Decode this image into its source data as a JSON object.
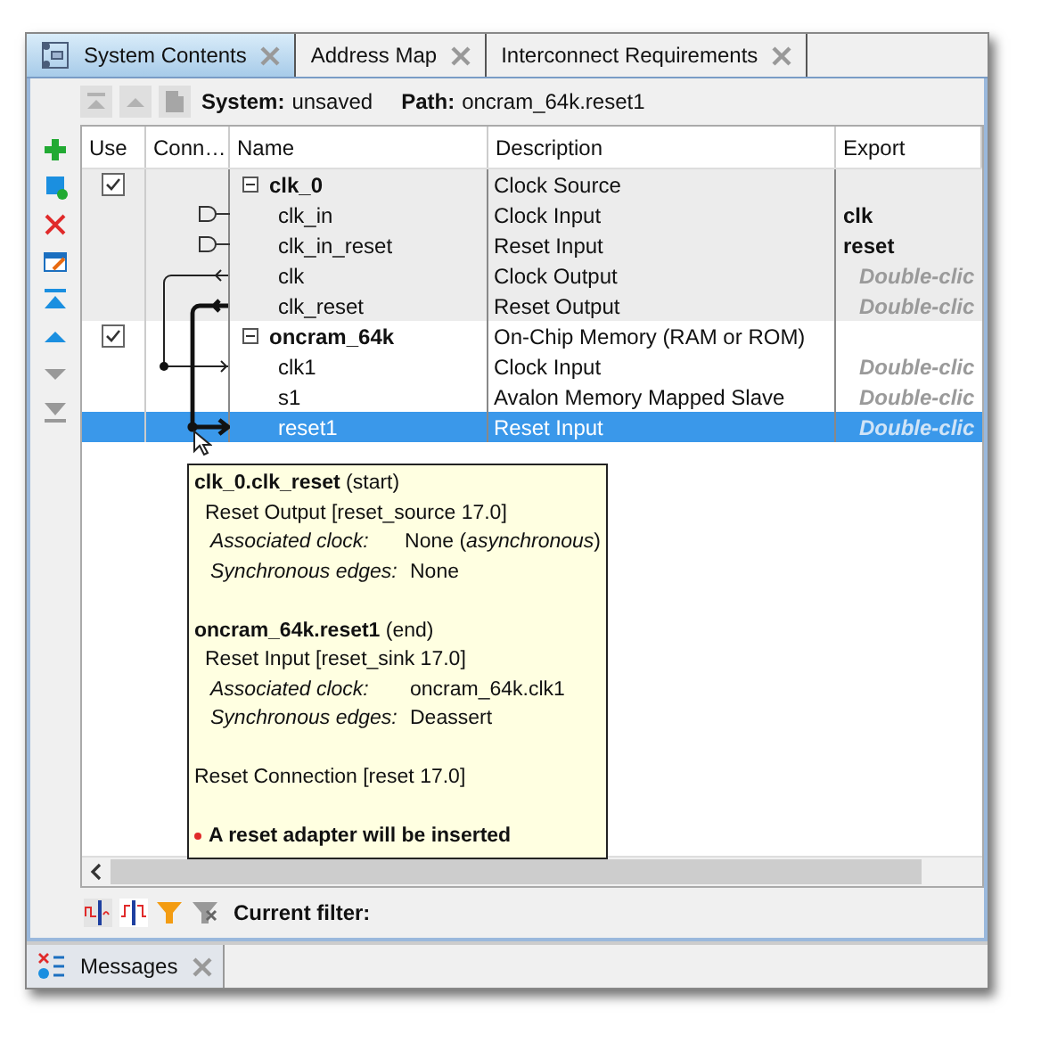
{
  "tabs": [
    {
      "label": "System Contents",
      "selected": true,
      "kind": "system"
    },
    {
      "label": "Address Map",
      "selected": false
    },
    {
      "label": "Interconnect Requirements",
      "selected": false
    }
  ],
  "toolbar": {
    "buttons": [
      {
        "kind": "top",
        "disabled": true
      },
      {
        "kind": "up",
        "disabled": true
      },
      {
        "kind": "hierarchy",
        "disabled": true
      }
    ],
    "system_label": "System:",
    "system_value": "unsaved",
    "path_label": "Path:",
    "path_value": "oncram_64k.reset1"
  },
  "side_tools": [
    {
      "kind": "add",
      "disabled": false
    },
    {
      "kind": "add-block",
      "disabled": false
    },
    {
      "kind": "remove",
      "disabled": false
    },
    {
      "kind": "edit",
      "disabled": false
    },
    {
      "kind": "top",
      "disabled": false
    },
    {
      "kind": "up",
      "disabled": false
    },
    {
      "kind": "down",
      "disabled": true
    },
    {
      "kind": "bottom",
      "disabled": true
    }
  ],
  "table": {
    "columns": [
      "Use",
      "Conn…",
      "Name",
      "Description",
      "Export"
    ],
    "modules": [
      {
        "name": "clk_0",
        "description": "Clock Source",
        "checked": true,
        "expanded": true,
        "selected": false,
        "children": [
          {
            "name": "clk_in",
            "description": "Clock Input",
            "export": "clk",
            "exported": true,
            "selected": false
          },
          {
            "name": "clk_in_reset",
            "description": "Reset Input",
            "export": "reset",
            "exported": true,
            "selected": false
          },
          {
            "name": "clk",
            "description": "Clock Output",
            "export": "Double-clic",
            "exported": false,
            "selected": false
          },
          {
            "name": "clk_reset",
            "description": "Reset Output",
            "export": "Double-clic",
            "exported": false,
            "selected": false
          }
        ]
      },
      {
        "name": "oncram_64k",
        "description": "On-Chip Memory (RAM or ROM)",
        "checked": true,
        "expanded": true,
        "selected": false,
        "children": [
          {
            "name": "clk1",
            "description": "Clock Input",
            "export": "Double-clic",
            "exported": false,
            "selected": false
          },
          {
            "name": "s1",
            "description": "Avalon Memory Mapped Slave",
            "export": "Double-clic",
            "exported": false,
            "selected": false
          },
          {
            "name": "reset1",
            "description": "Reset Input",
            "export": "Double-clic",
            "exported": false,
            "selected": true
          }
        ]
      }
    ]
  },
  "tooltip": {
    "lines": [
      {
        "kind": "heading",
        "text": "**clk_0.clk_reset** (start)"
      },
      {
        "kind": "sub",
        "text": "Reset Output [reset_source 17.0]"
      },
      {
        "kind": "pair",
        "label": "Associated clock:",
        "value": "None (*asynchronous*)"
      },
      {
        "kind": "pair",
        "label": "Synchronous edges:",
        "value": "None"
      },
      {
        "kind": "gap"
      },
      {
        "kind": "heading",
        "text": "**oncram_64k.reset1** (end)"
      },
      {
        "kind": "sub",
        "text": "Reset Input [reset_sink 17.0]"
      },
      {
        "kind": "pair",
        "label": "Associated clock:",
        "value": "oncram_64k.clk1"
      },
      {
        "kind": "pair",
        "label": "Synchronous edges:",
        "value": "Deassert"
      },
      {
        "kind": "gap"
      },
      {
        "kind": "plain",
        "text": "Reset Connection [reset 17.0]"
      },
      {
        "kind": "gap"
      },
      {
        "kind": "warning",
        "text": "A reset adapter will be inserted"
      }
    ]
  },
  "filter_bar": {
    "label": "Current filter:"
  },
  "bottom_tabs": [
    {
      "label": "Messages",
      "selected": false
    }
  ]
}
